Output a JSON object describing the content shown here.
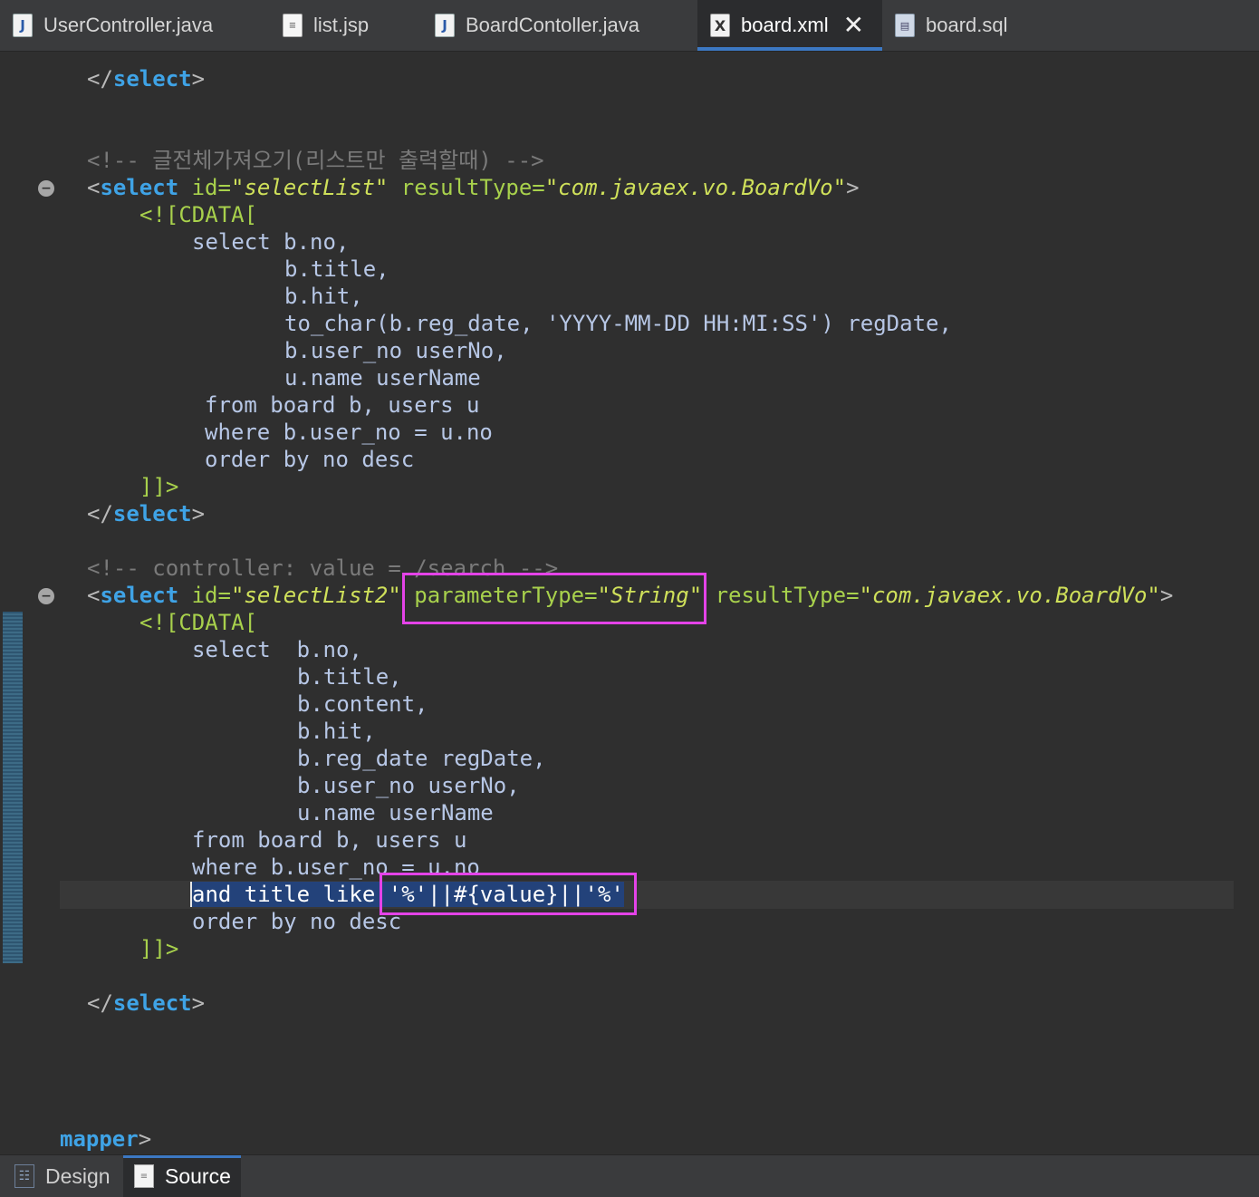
{
  "tabs": [
    {
      "label": "UserController.java",
      "icon": "java-file-icon",
      "glyph": "J"
    },
    {
      "label": "list.jsp",
      "icon": "jsp-file-icon",
      "glyph": "≡"
    },
    {
      "label": "BoardContoller.java",
      "icon": "java-file-icon",
      "glyph": "J"
    },
    {
      "label": "board.xml",
      "icon": "xml-file-icon",
      "glyph": "X",
      "active": true,
      "close": "✕"
    },
    {
      "label": "board.sql",
      "icon": "sql-file-icon",
      "glyph": "▤"
    }
  ],
  "code": {
    "l1": {
      "a": "</",
      "b": "select",
      "c": ">"
    },
    "l2": {
      "comment": "<!-- 글전체가져오기(리스트만 출력할때) -->"
    },
    "l3": {
      "open": "<",
      "tag": "select",
      "a1": " id=",
      "v1": "\"selectList\"",
      "a2": " resultType=",
      "v2": "\"com.javaex.vo.BoardVo\"",
      "close": ">"
    },
    "l4": "<![CDATA[",
    "l5": "select b.no,",
    "l6": "b.title,",
    "l7": "b.hit,",
    "l8": "to_char(b.reg_date, 'YYYY-MM-DD HH:MI:SS') regDate,",
    "l9": "b.user_no userNo,",
    "l10": "u.name userName",
    "l11": "from board b, users u",
    "l12": "where b.user_no = u.no",
    "l13": "order by no desc",
    "l14": "]]>",
    "l15": {
      "a": "</",
      "b": "select",
      "c": ">"
    },
    "l16": {
      "comment": "<!-- controller: value = /search -->"
    },
    "l17": {
      "open": "<",
      "tag": "select",
      "a1": " id=",
      "v1": "\"selectList2\"",
      "a2": " parameterType=",
      "v2": "\"String\"",
      "a3": " resultType=",
      "v3": "\"com.javaex.vo.BoardVo\"",
      "close": ">"
    },
    "l18": "<![CDATA[",
    "l19": "select  b.no,",
    "l20": "b.title,",
    "l21": "b.content,",
    "l22": "b.hit,",
    "l23": "b.reg_date regDate,",
    "l24": "b.user_no userNo,",
    "l25": "u.name userName",
    "l26": "from board b, users u",
    "l27": "where b.user_no = u.no",
    "l28": {
      "sel": "and title like ",
      "sel2": "'%'||#{value}||'%'"
    },
    "l29": "order by no desc",
    "l30": "]]>",
    "l31": {
      "a": "</",
      "b": "select",
      "c": ">"
    },
    "l32": {
      "tag": "mapper",
      "c": ">"
    }
  },
  "fold_glyph": "−",
  "bottom_tabs": [
    {
      "label": "Design",
      "icon": "design-icon",
      "glyph": "☷"
    },
    {
      "label": "Source",
      "icon": "source-icon",
      "glyph": "≡",
      "active": true
    }
  ],
  "colors": {
    "highlight_box": "#e443e8",
    "selection": "#23427a",
    "tag": "#3fa3e6",
    "attribute": "#a8d14c"
  }
}
